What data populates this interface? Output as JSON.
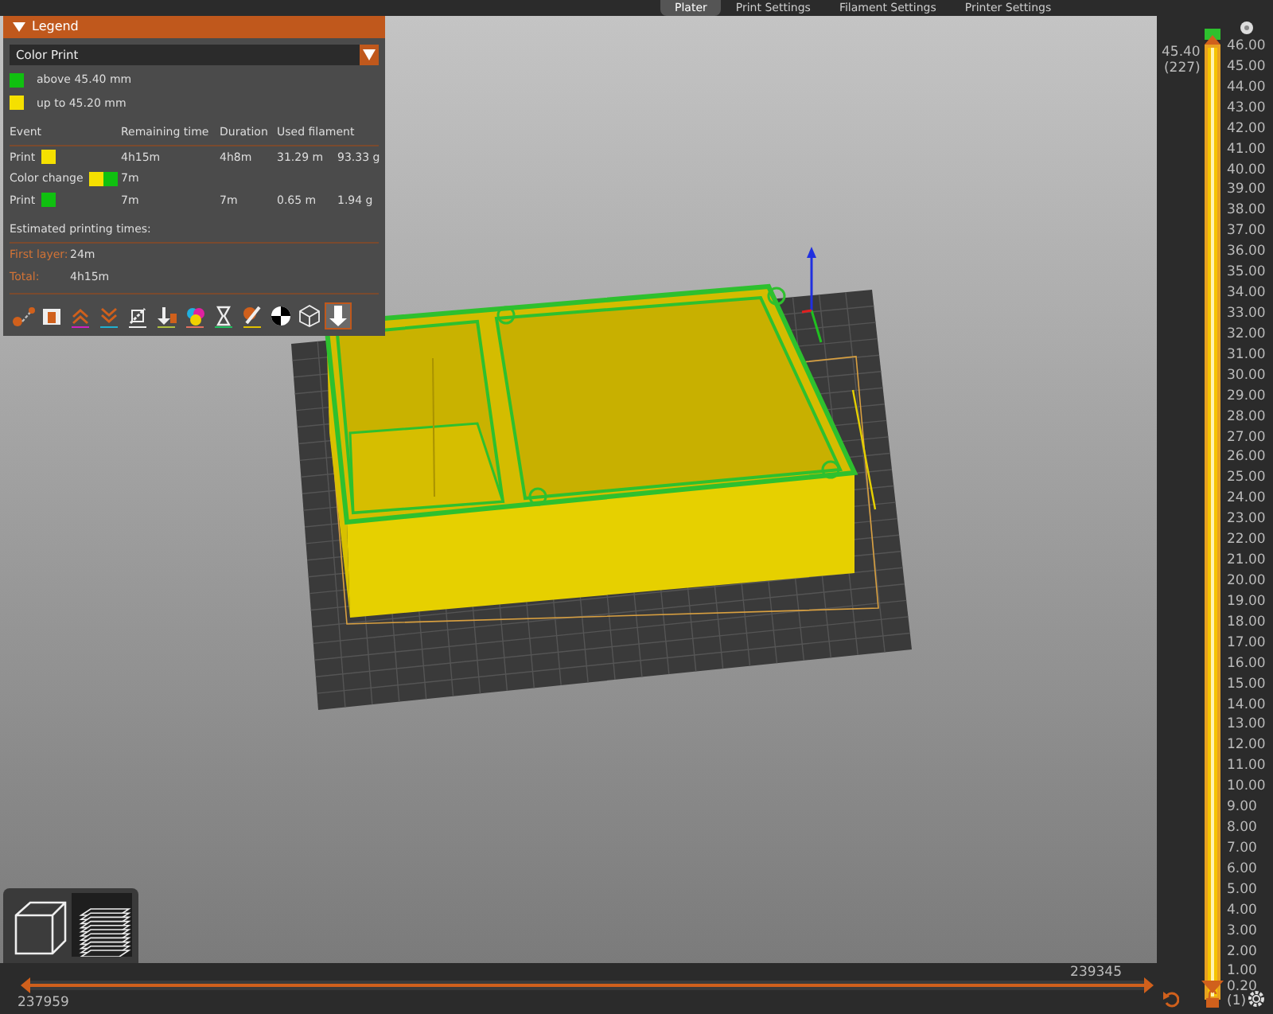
{
  "tabs": [
    {
      "label": "Plater",
      "selected": true
    },
    {
      "label": "Print Settings",
      "selected": false
    },
    {
      "label": "Filament Settings",
      "selected": false
    },
    {
      "label": "Printer Settings",
      "selected": false
    }
  ],
  "legend": {
    "title": "Legend",
    "expanded": true,
    "view_type": "Color Print",
    "colors": [
      {
        "label": "above 45.40 mm",
        "color": "#10c010"
      },
      {
        "label": "up to 45.20 mm",
        "color": "#f5e000"
      }
    ],
    "columns": [
      "Event",
      "Remaining time",
      "Duration",
      "Used filament"
    ],
    "rows": [
      {
        "event": "Print",
        "swatches": [
          {
            "color": "#f5e000"
          }
        ],
        "remaining": "4h15m",
        "duration": "4h8m",
        "length": "31.29 m",
        "weight": "93.33 g"
      },
      {
        "event": "Color change",
        "swatches": [
          {
            "color": "#f5e000"
          },
          {
            "color": "#10c010"
          }
        ],
        "remaining": "7m"
      },
      {
        "event": "Print",
        "swatches": [
          {
            "color": "#10c010"
          }
        ],
        "remaining": "7m",
        "duration": "7m",
        "length": "0.65 m",
        "weight": "1.94 g"
      }
    ],
    "estimated_title": "Estimated printing times:",
    "times": [
      {
        "label": "First layer:",
        "value": "24m"
      },
      {
        "label": "Total:",
        "value": "4h15m"
      }
    ],
    "options": [
      {
        "kind": "travel",
        "selected": false
      },
      {
        "kind": "wipe",
        "selected": false
      },
      {
        "kind": "retract",
        "selected": false
      },
      {
        "kind": "deretract",
        "selected": false
      },
      {
        "kind": "seam",
        "selected": false
      },
      {
        "kind": "tool",
        "selected": false
      },
      {
        "kind": "color",
        "selected": false
      },
      {
        "kind": "pause",
        "selected": false
      },
      {
        "kind": "custom",
        "selected": false
      },
      {
        "kind": "gravity",
        "selected": false
      },
      {
        "kind": "shell",
        "selected": false
      },
      {
        "kind": "marker",
        "selected": true
      }
    ]
  },
  "view_buttons": [
    {
      "kind": "model",
      "selected": false
    },
    {
      "kind": "layers",
      "selected": true
    }
  ],
  "vertical_slider": {
    "upper_value": "45.40",
    "upper_layer": "(227)",
    "ticks": [
      "46.00",
      "45.00",
      "44.00",
      "43.00",
      "42.00",
      "41.00",
      "40.00",
      "39.00",
      "38.00",
      "37.00",
      "36.00",
      "35.00",
      "34.00",
      "33.00",
      "32.00",
      "31.00",
      "30.00",
      "29.00",
      "28.00",
      "27.00",
      "26.00",
      "25.00",
      "24.00",
      "23.00",
      "22.00",
      "21.00",
      "20.00",
      "19.00",
      "18.00",
      "17.00",
      "16.00",
      "15.00",
      "14.00",
      "13.00",
      "12.00",
      "11.00",
      "10.00",
      "9.00",
      "8.00",
      "7.00",
      "6.00",
      "5.00",
      "4.00",
      "3.00",
      "2.00",
      "1.00"
    ],
    "lower_value": "0.20",
    "lower_layer": "(1)"
  },
  "horizontal_slider": {
    "level": 1,
    "upper_value": "239345",
    "lower_value": "237959"
  }
}
